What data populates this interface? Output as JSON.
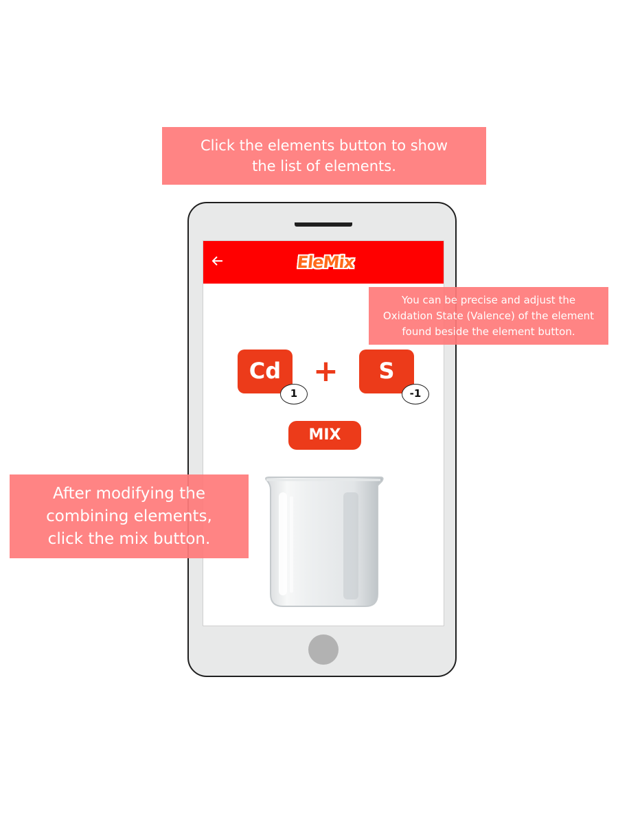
{
  "callouts": {
    "top": [
      "Click the elements button to show",
      "the list of elements."
    ],
    "right": [
      "You can be precise and adjust the",
      "Oxidation State (Valence) of the element",
      "found beside the element button."
    ],
    "left": [
      "After modifying the",
      "combining elements,",
      "click  the mix button."
    ]
  },
  "app": {
    "logo_text": "EleMix",
    "back_icon": "arrow-left-icon",
    "appbar_color": "#ff0000",
    "accent_color": "#ec3b1a"
  },
  "reaction": {
    "element_1": {
      "symbol": "Cd",
      "valence": "1"
    },
    "operator": "+",
    "element_2": {
      "symbol": "S",
      "valence": "-1"
    }
  },
  "mix_button_label": "MIX"
}
